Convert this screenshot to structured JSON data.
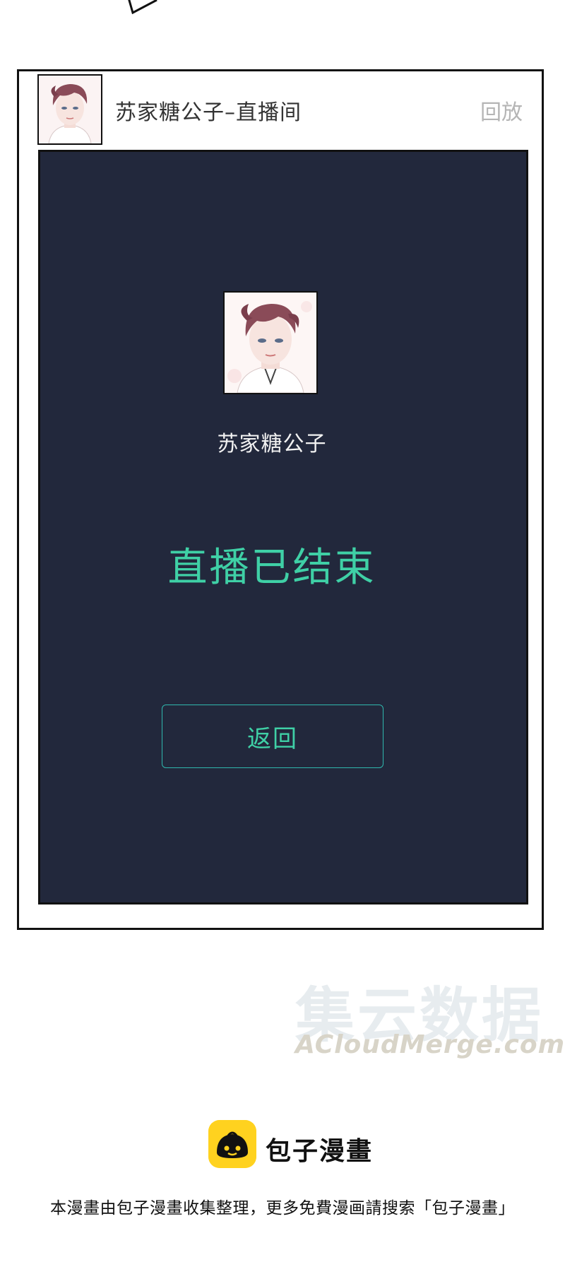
{
  "live_page": {
    "header_title": "苏家糖公子–直播间",
    "replay_label": "回放",
    "host_name": "苏家糖公子",
    "status_text": "直播已结束",
    "back_button_label": "返回"
  },
  "watermark": {
    "text_cn": "集云数据",
    "text_en": "ACloudMerge.com"
  },
  "footer": {
    "brand_name": "包子漫畫",
    "note": "本漫畫由包子漫畫收集整理，更多免費漫画請搜索「包子漫畫」"
  },
  "colors": {
    "screen_bg": "#22283c",
    "accent_green": "#3fd0a6",
    "logo_yellow": "#ffd21f"
  }
}
